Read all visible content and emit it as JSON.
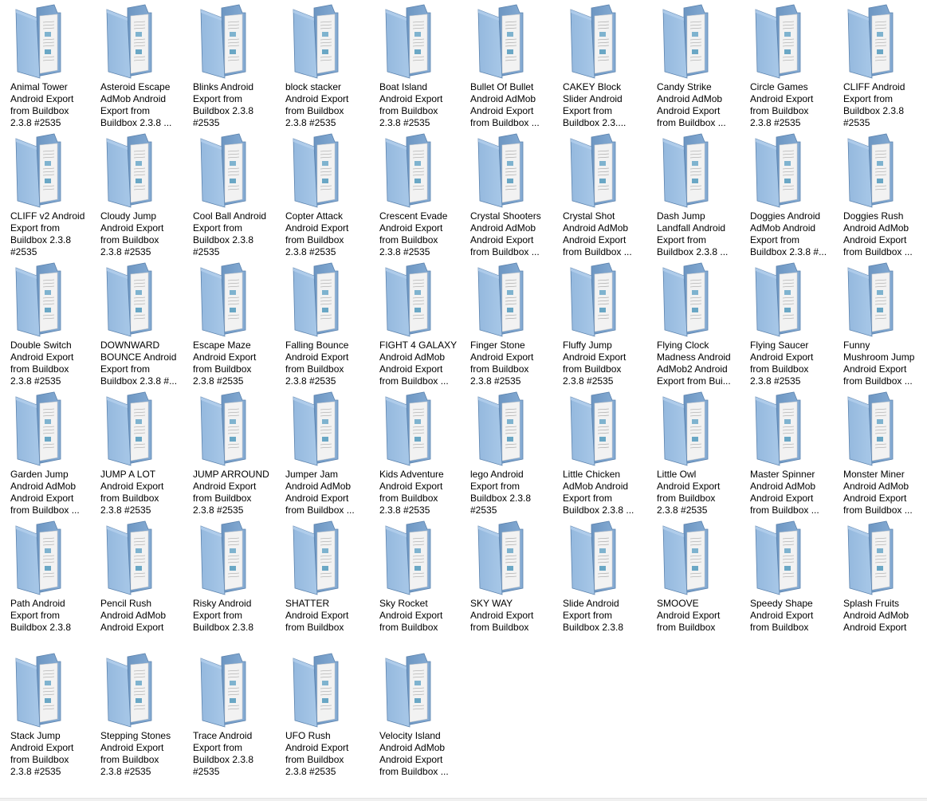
{
  "colors": {
    "folder_front": "#8fb5dc",
    "folder_back": "#6d96c2",
    "paper": "#f2f2f2"
  },
  "folders": [
    {
      "label": "Animal Tower\nAndroid Export\nfrom Buildbox\n2.3.8 #2535"
    },
    {
      "label": "Asteroid Escape\nAdMob Android\nExport from\nBuildbox 2.3.8 ..."
    },
    {
      "label": "Blinks Android\nExport from\nBuildbox 2.3.8\n#2535"
    },
    {
      "label": "block stacker\nAndroid Export\nfrom Buildbox\n2.3.8 #2535"
    },
    {
      "label": "Boat Island\nAndroid Export\nfrom Buildbox\n2.3.8 #2535"
    },
    {
      "label": "Bullet Of Bullet\nAndroid AdMob\nAndroid Export\nfrom Buildbox ..."
    },
    {
      "label": "CAKEY Block\nSlider Android\nExport from\nBuildbox 2.3...."
    },
    {
      "label": "Candy Strike\nAndroid AdMob\nAndroid Export\nfrom Buildbox ..."
    },
    {
      "label": "Circle Games\nAndroid Export\nfrom Buildbox\n2.3.8 #2535"
    },
    {
      "label": "CLIFF Android\nExport from\nBuildbox 2.3.8\n#2535"
    },
    {
      "label": "CLIFF v2 Android\nExport from\nBuildbox 2.3.8\n#2535"
    },
    {
      "label": "Cloudy Jump\nAndroid Export\nfrom Buildbox\n2.3.8 #2535"
    },
    {
      "label": "Cool Ball Android\nExport from\nBuildbox 2.3.8\n#2535"
    },
    {
      "label": "Copter Attack\nAndroid Export\nfrom Buildbox\n2.3.8 #2535"
    },
    {
      "label": "Crescent Evade\nAndroid Export\nfrom Buildbox\n2.3.8 #2535"
    },
    {
      "label": "Crystal Shooters\nAndroid AdMob\nAndroid Export\nfrom Buildbox ..."
    },
    {
      "label": "Crystal Shot\nAndroid AdMob\nAndroid Export\nfrom Buildbox ..."
    },
    {
      "label": "Dash Jump\nLandfall Android\nExport from\nBuildbox 2.3.8 ..."
    },
    {
      "label": "Doggies Android\nAdMob Android\nExport from\nBuildbox 2.3.8 #..."
    },
    {
      "label": "Doggies Rush\nAndroid AdMob\nAndroid Export\nfrom Buildbox ..."
    },
    {
      "label": "Double Switch\nAndroid Export\nfrom Buildbox\n2.3.8 #2535"
    },
    {
      "label": "DOWNWARD\nBOUNCE Android\nExport from\nBuildbox 2.3.8 #..."
    },
    {
      "label": "Escape Maze\nAndroid Export\nfrom Buildbox\n2.3.8 #2535"
    },
    {
      "label": "Falling Bounce\nAndroid Export\nfrom Buildbox\n2.3.8 #2535"
    },
    {
      "label": "FIGHT 4 GALAXY\nAndroid AdMob\nAndroid Export\nfrom Buildbox ..."
    },
    {
      "label": "Finger Stone\nAndroid Export\nfrom Buildbox\n2.3.8 #2535"
    },
    {
      "label": "Fluffy Jump\nAndroid Export\nfrom Buildbox\n2.3.8 #2535"
    },
    {
      "label": "Flying Clock\nMadness Android\nAdMob2 Android\nExport from Bui..."
    },
    {
      "label": "Flying Saucer\nAndroid Export\nfrom Buildbox\n2.3.8 #2535"
    },
    {
      "label": "Funny\nMushroom Jump\nAndroid Export\nfrom Buildbox ..."
    },
    {
      "label": "Garden Jump\nAndroid AdMob\nAndroid Export\nfrom Buildbox ..."
    },
    {
      "label": "JUMP A LOT\nAndroid Export\nfrom Buildbox\n2.3.8 #2535"
    },
    {
      "label": "JUMP ARROUND\nAndroid Export\nfrom Buildbox\n2.3.8 #2535"
    },
    {
      "label": "Jumper Jam\nAndroid AdMob\nAndroid Export\nfrom Buildbox ..."
    },
    {
      "label": "Kids Adventure\nAndroid Export\nfrom Buildbox\n2.3.8 #2535"
    },
    {
      "label": "lego Android\nExport from\nBuildbox 2.3.8\n#2535"
    },
    {
      "label": "Little Chicken\nAdMob Android\nExport from\nBuildbox 2.3.8 ..."
    },
    {
      "label": "Little Owl\nAndroid Export\nfrom Buildbox\n2.3.8 #2535"
    },
    {
      "label": "Master Spinner\nAndroid AdMob\nAndroid Export\nfrom Buildbox ..."
    },
    {
      "label": "Monster Miner\nAndroid AdMob\nAndroid Export\nfrom Buildbox ..."
    },
    {
      "label": "Path Android\nExport from\nBuildbox 2.3.8"
    },
    {
      "label": "Pencil Rush\nAndroid AdMob\nAndroid Export"
    },
    {
      "label": "Risky Android\nExport from\nBuildbox 2.3.8"
    },
    {
      "label": "SHATTER\nAndroid Export\nfrom Buildbox"
    },
    {
      "label": "Sky Rocket\nAndroid Export\nfrom Buildbox"
    },
    {
      "label": "SKY WAY\nAndroid Export\nfrom Buildbox"
    },
    {
      "label": "Slide Android\nExport from\nBuildbox 2.3.8"
    },
    {
      "label": "SMOOVE\nAndroid Export\nfrom Buildbox"
    },
    {
      "label": "Speedy Shape\nAndroid Export\nfrom Buildbox"
    },
    {
      "label": "Splash Fruits\nAndroid AdMob\nAndroid Export"
    },
    {
      "label": "Stack Jump\nAndroid Export\nfrom Buildbox\n2.3.8 #2535"
    },
    {
      "label": "Stepping Stones\nAndroid Export\nfrom Buildbox\n2.3.8 #2535"
    },
    {
      "label": "Trace Android\nExport from\nBuildbox 2.3.8\n#2535"
    },
    {
      "label": "UFO Rush\nAndroid Export\nfrom Buildbox\n2.3.8 #2535"
    },
    {
      "label": "Velocity Island\nAndroid AdMob\nAndroid Export\nfrom Buildbox ..."
    }
  ]
}
